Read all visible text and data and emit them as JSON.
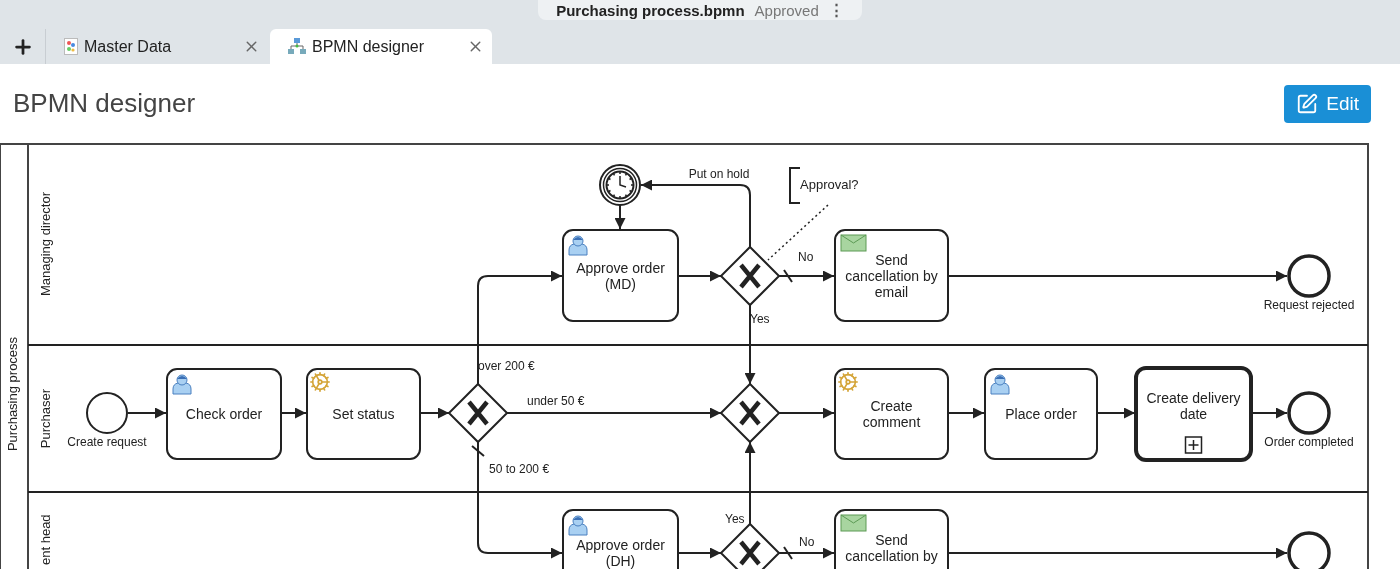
{
  "document": {
    "name": "Purchasing process.bpmn",
    "status": "Approved",
    "menu": "⋮"
  },
  "tabs": [
    {
      "label": "Master Data",
      "selected": false,
      "kind": "data"
    },
    {
      "label": "BPMN designer",
      "selected": true,
      "kind": "diagram"
    }
  ],
  "page": {
    "title": "BPMN designer",
    "edit_button": "Edit"
  },
  "diagram": {
    "pool": "Purchasing process",
    "lanes": [
      "Managing director",
      "Purchaser",
      "ent head"
    ],
    "nodes": [
      {
        "kind": "timer"
      },
      {
        "kind": "user_task",
        "lines": [
          "Approve order",
          "(MD)"
        ]
      },
      {
        "kind": "gateway"
      },
      {
        "kind": "send_task",
        "lines": [
          "Send",
          "cancellation by",
          "email"
        ]
      },
      {
        "kind": "end",
        "label": "Request rejected"
      },
      {
        "kind": "start",
        "label": "Create request"
      },
      {
        "kind": "user_task",
        "lines": [
          "Check order"
        ]
      },
      {
        "kind": "service_task",
        "lines": [
          "Set status"
        ]
      },
      {
        "kind": "gateway"
      },
      {
        "kind": "gateway"
      },
      {
        "kind": "service_task",
        "lines": [
          "Create",
          "comment"
        ]
      },
      {
        "kind": "user_task",
        "lines": [
          "Place order"
        ]
      },
      {
        "kind": "subprocess",
        "lines": [
          "Create delivery",
          "date"
        ]
      },
      {
        "kind": "end",
        "label": "Order completed"
      },
      {
        "kind": "user_task",
        "lines": [
          "Approve order",
          "(DH)"
        ]
      },
      {
        "kind": "gateway"
      },
      {
        "kind": "send_task",
        "lines": [
          "Send",
          "cancellation by"
        ]
      },
      {
        "kind": "end"
      },
      {
        "kind": "annotation",
        "text": "Approval?"
      }
    ],
    "flow_labels": [
      "Put on hold",
      "No",
      "Yes",
      "over 200 €",
      "under 50 €",
      "50 to 200 €",
      "Yes",
      "No"
    ]
  }
}
